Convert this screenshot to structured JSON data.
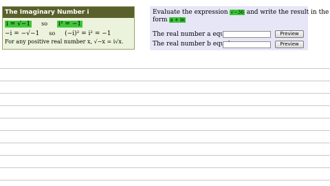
{
  "imaginary_panel": {
    "title": "The Imaginary Number i",
    "row1_left": "i = √−1",
    "row1_so": "so",
    "row1_right": "i² = −1",
    "row2_left": "−i = −√−1",
    "row2_so": "so",
    "row2_right": "(−i)² = i² = −1",
    "row3": "For any positive real number x, √−x = i√x."
  },
  "exercise": {
    "prompt_start": "Evaluate the expression",
    "expression": "√−36",
    "prompt_end": "and write the result in the",
    "form_label": "form",
    "form_value": "a + bi",
    "a_label": "The real number a equals",
    "b_label": "The real number b equals",
    "a_value": "",
    "b_value": "",
    "preview_label": "Preview"
  },
  "colors": {
    "title_bar": "#59602c",
    "highlight": "#3ec63a",
    "exercise_bg": "#e6e6f7"
  }
}
